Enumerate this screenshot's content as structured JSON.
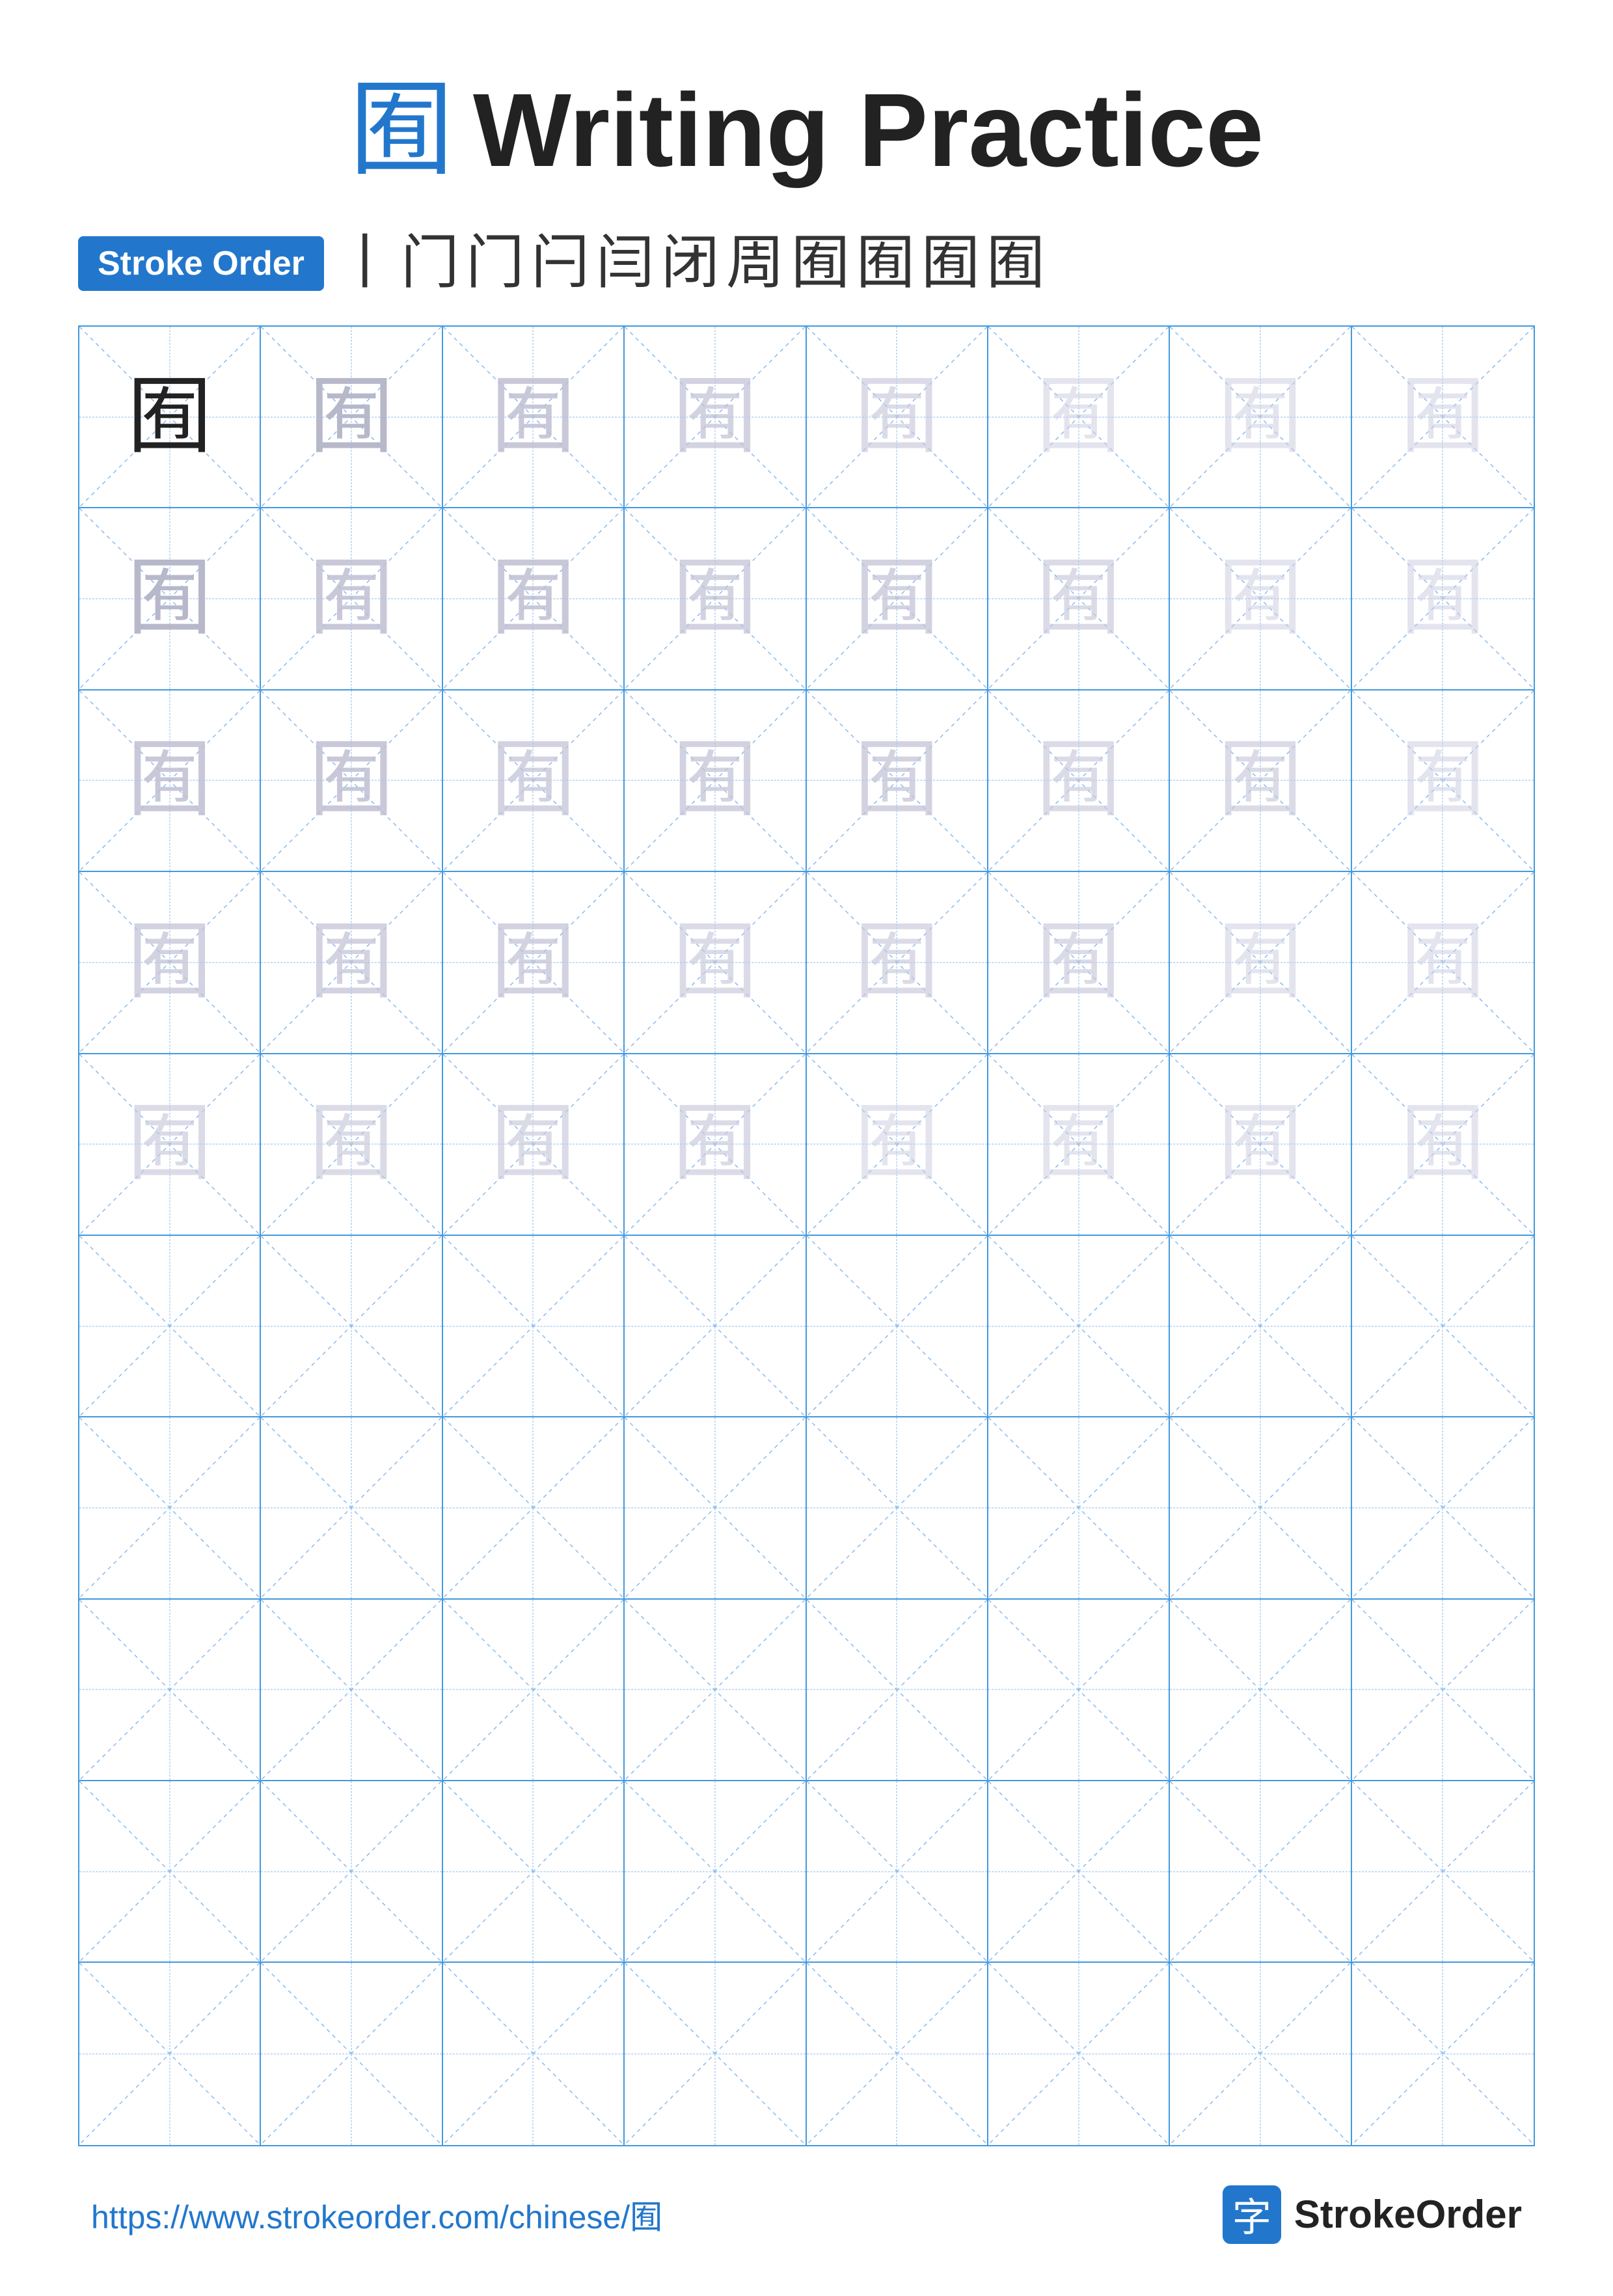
{
  "title": {
    "char": "囿",
    "text": "Writing Practice"
  },
  "stroke_order": {
    "badge_label": "Stroke Order",
    "chars": [
      "丨",
      "门",
      "门",
      "闩",
      "闫",
      "闭",
      "周",
      "囿",
      "囿",
      "囿",
      "囿"
    ]
  },
  "grid": {
    "rows": 10,
    "cols": 8,
    "char": "囿",
    "filled_rows": 5,
    "ghost_levels": [
      0,
      1,
      2,
      3,
      4,
      5,
      5,
      5
    ]
  },
  "footer": {
    "url": "https://www.strokeorder.com/chinese/囿",
    "brand": "StrokeOrder",
    "logo_char": "字"
  }
}
